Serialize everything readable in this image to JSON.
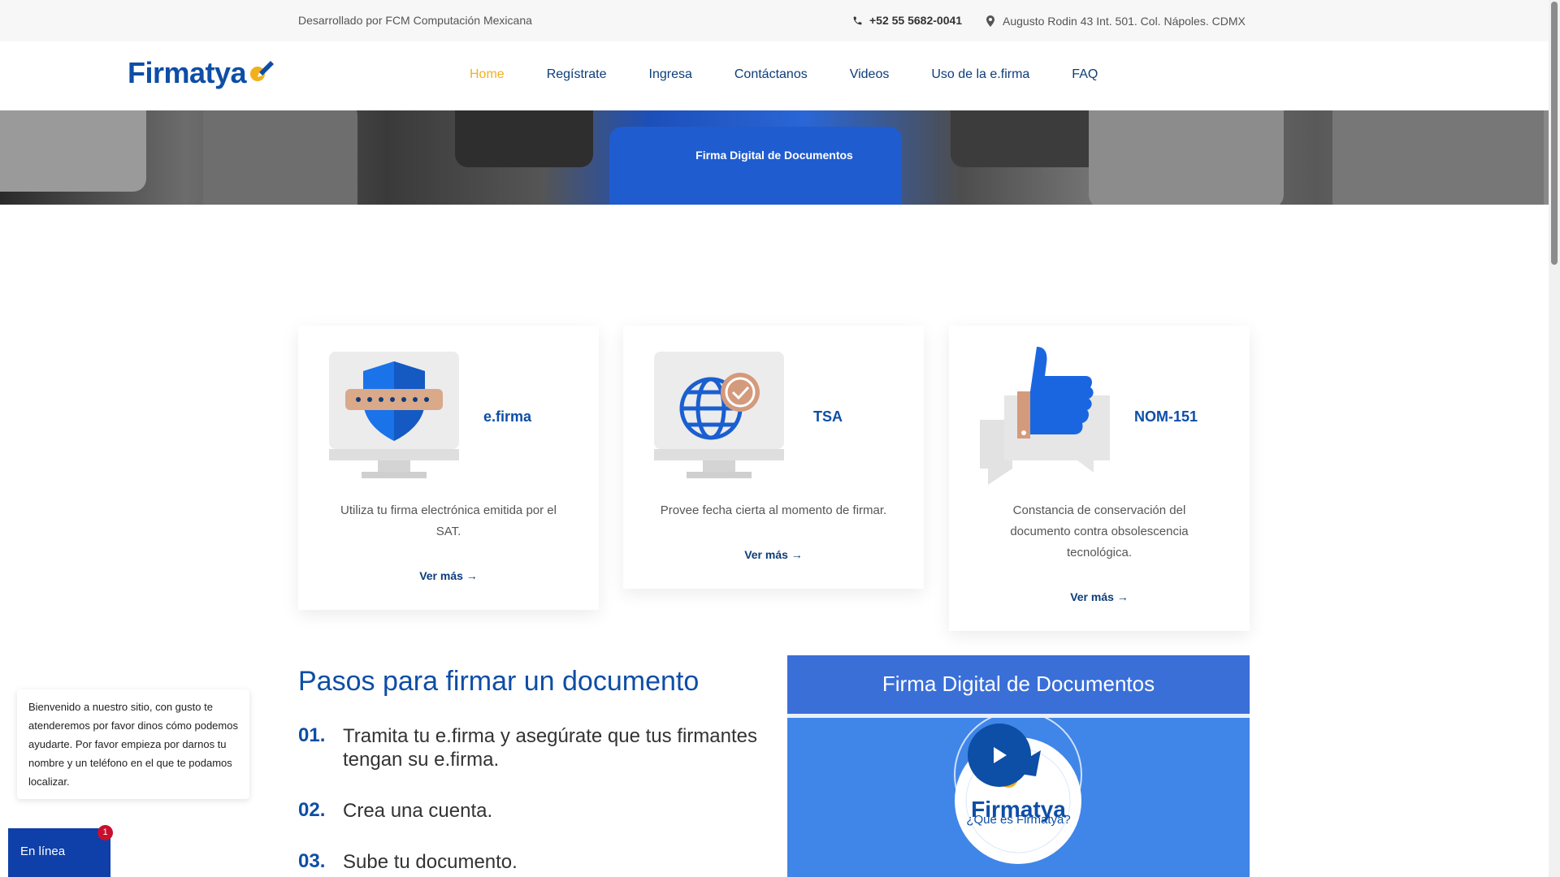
{
  "topbar": {
    "developer": "Desarrollado por FCM Computación Mexicana",
    "phone": "+52 55 5682-0041",
    "address": "Augusto Rodin 43 Int. 501. Col. Nápoles. CDMX",
    "phone_icon": "phone-icon",
    "address_icon": "map-pin-icon"
  },
  "logo": {
    "text": "Firmatya"
  },
  "nav": {
    "items": [
      {
        "label": "Home",
        "active": true
      },
      {
        "label": "Regístrate"
      },
      {
        "label": "Ingresa"
      },
      {
        "label": "Contáctanos"
      },
      {
        "label": "Videos"
      },
      {
        "label": "Uso de la e.firma"
      },
      {
        "label": "FAQ"
      }
    ]
  },
  "hero": {
    "title": "Firma Digital de Documentos"
  },
  "cards": [
    {
      "title": "e.firma",
      "description": "Utiliza tu firma electrónica emitida por el SAT.",
      "link": "Ver más →",
      "icon": "shield-icon"
    },
    {
      "title": "TSA",
      "description": "Provee fecha cierta al momento de firmar.",
      "link": "Ver más →",
      "icon": "globe-icon"
    },
    {
      "title": "NOM-151",
      "description": "Constancia de conservación del documento contra obsolescencia tecnológica.",
      "link": "Ver más →",
      "icon": "thumbs-up-icon"
    }
  ],
  "steps": {
    "title": "Pasos para firmar un documento",
    "items": [
      {
        "num": "01.",
        "text": "Tramita tu e.firma y asegúrate que tus firmantes tengan su e.firma."
      },
      {
        "num": "02.",
        "text": "Crea una cuenta."
      },
      {
        "num": "03.",
        "text": "Sube tu documento."
      }
    ]
  },
  "video": {
    "header": "Firma Digital de Documentos",
    "logo_text": "Firmatya",
    "caption": "¿Qué es Firmatya?"
  },
  "chat": {
    "message": "Bienvenido a nuestro sitio, con gusto te atenderemos por favor dinos cómo podemos ayudarte. Por favor empieza por darnos tu nombre y un teléfono en el que te podamos localizar.",
    "status": "En línea",
    "badge": "1"
  },
  "colors": {
    "primary": "#0d4ea6",
    "accent": "#f2b01e",
    "chat": "#0f3fa8"
  }
}
